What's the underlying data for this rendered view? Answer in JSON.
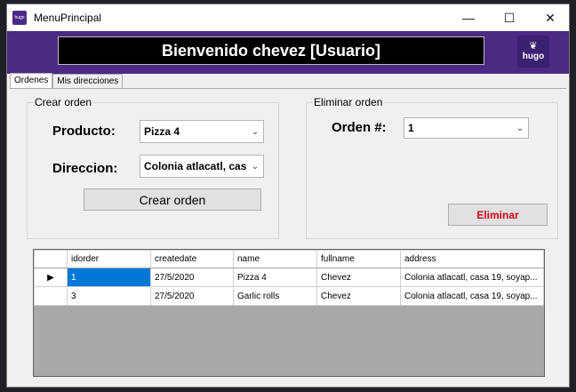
{
  "window": {
    "title": "MenuPrincipal",
    "icon_text": "hugo"
  },
  "controls": {
    "minimize": "—",
    "maximize": "☐",
    "close": "✕"
  },
  "header": {
    "welcome": "Bienvenido chevez [Usuario]",
    "logo_text": "hugo"
  },
  "tabs": [
    {
      "label": "Ordenes",
      "active": true
    },
    {
      "label": "Mis direcciones",
      "active": false
    }
  ],
  "crear_orden": {
    "title": "Crear orden",
    "producto_label": "Producto:",
    "producto_value": "Pizza 4",
    "direccion_label": "Direccion:",
    "direccion_value": "Colonia atlacatl, cas",
    "button": "Crear orden"
  },
  "eliminar_orden": {
    "title": "Eliminar orden",
    "orden_label": "Orden #:",
    "orden_value": "1",
    "button": "Eliminar",
    "button_color": "#d9001b"
  },
  "grid": {
    "columns": [
      "idorder",
      "createdate",
      "name",
      "fullname",
      "address"
    ],
    "rows": [
      [
        "1",
        "27/5/2020",
        "Pizza 4",
        "Chevez",
        "Colonia atlacatl, casa 19, soyap..."
      ],
      [
        "3",
        "27/5/2020",
        "Garlic rolls",
        "Chevez",
        "Colonia atlacatl, casa 19, soyap..."
      ]
    ],
    "current_row_marker": "▶"
  },
  "colors": {
    "accent": "#4b2a84",
    "selection": "#0078d7"
  }
}
